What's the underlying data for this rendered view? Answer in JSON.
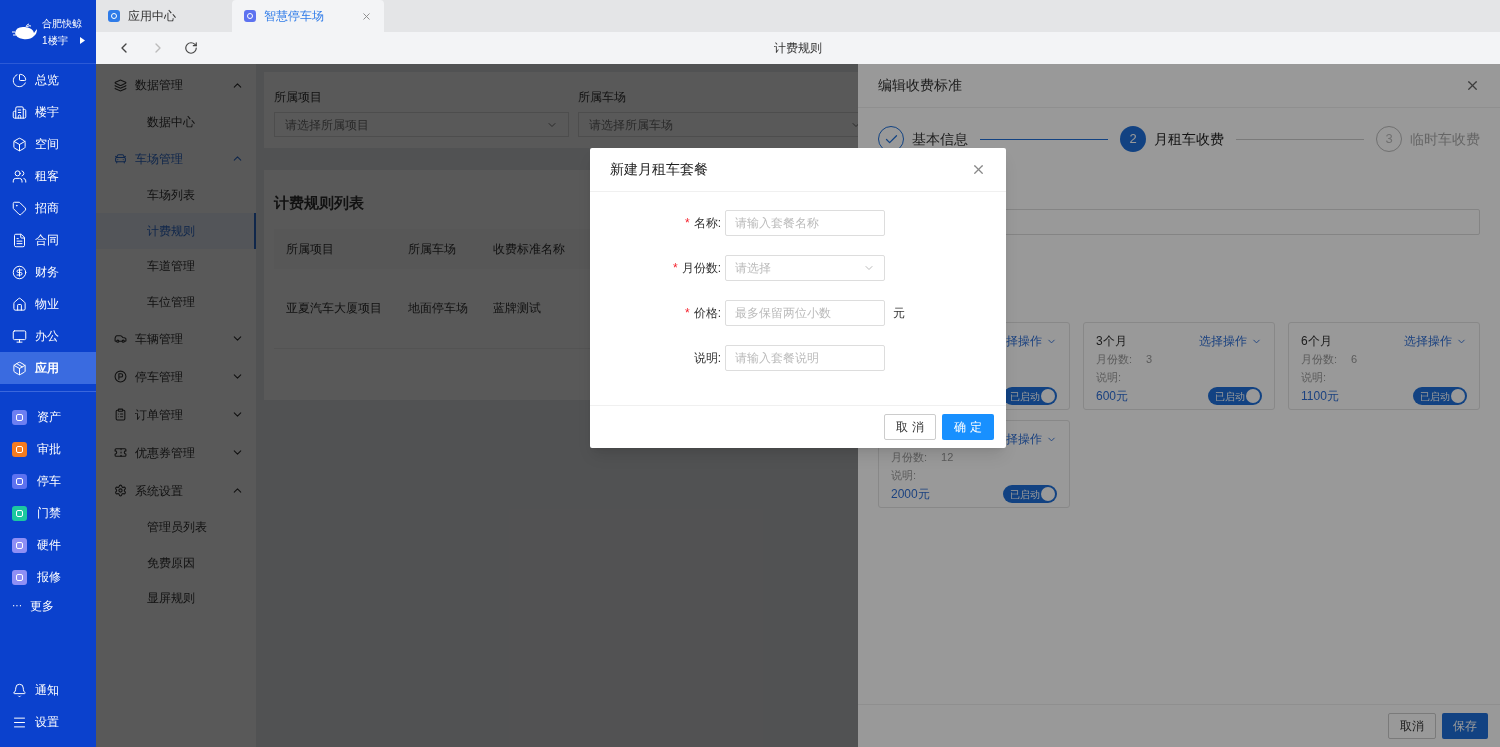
{
  "app_sidebar": {
    "org": "合肥快鲸",
    "building": "1楼宇",
    "nav": [
      {
        "label": "总览",
        "selected": false
      },
      {
        "label": "楼宇",
        "selected": false
      },
      {
        "label": "空间",
        "selected": false
      },
      {
        "label": "租客",
        "selected": false
      },
      {
        "label": "招商",
        "selected": false
      },
      {
        "label": "合同",
        "selected": false
      },
      {
        "label": "财务",
        "selected": false
      },
      {
        "label": "物业",
        "selected": false
      },
      {
        "label": "办公",
        "selected": false
      },
      {
        "label": "应用",
        "selected": true
      }
    ],
    "apps": [
      {
        "label": "资产",
        "color": "#6d7ff2"
      },
      {
        "label": "审批",
        "color": "#f47b20"
      },
      {
        "label": "停车",
        "color": "#5d72f0"
      },
      {
        "label": "门禁",
        "color": "#1cc8a0"
      },
      {
        "label": "硬件",
        "color": "#8f8ff5"
      },
      {
        "label": "报修",
        "color": "#8f8ff5"
      }
    ],
    "more": {
      "icon": "···",
      "label": "更多"
    },
    "bottom": [
      {
        "label": "通知"
      },
      {
        "label": "设置"
      }
    ]
  },
  "tabs": [
    {
      "label": "应用中心",
      "selected": false,
      "closable": false
    },
    {
      "label": "智慧停车场",
      "selected": true,
      "closable": true
    }
  ],
  "nav_bar": {
    "title": "计费规则"
  },
  "module_menu": [
    {
      "label": "数据管理",
      "expanded": true,
      "children": [
        {
          "label": "数据中心",
          "selected": false
        }
      ]
    },
    {
      "label": "车场管理",
      "expanded": true,
      "children": [
        {
          "label": "车场列表",
          "selected": false
        },
        {
          "label": "计费规则",
          "selected": true
        },
        {
          "label": "车道管理",
          "selected": false
        },
        {
          "label": "车位管理",
          "selected": false
        }
      ]
    },
    {
      "label": "车辆管理",
      "expanded": false
    },
    {
      "label": "停车管理",
      "expanded": false
    },
    {
      "label": "订单管理",
      "expanded": false
    },
    {
      "label": "优惠券管理",
      "expanded": false
    },
    {
      "label": "系统设置",
      "expanded": true,
      "children": [
        {
          "label": "管理员列表",
          "selected": false
        },
        {
          "label": "免费原因",
          "selected": false
        },
        {
          "label": "显屏规则",
          "selected": false
        }
      ]
    }
  ],
  "filters": [
    {
      "label": "所属项目",
      "placeholder": "请选择所属项目"
    },
    {
      "label": "所属车场",
      "placeholder": "请选择所属车场"
    }
  ],
  "rule_list": {
    "title": "计费规则列表",
    "columns": [
      "所属项目",
      "所属车场",
      "收费标准名称"
    ],
    "rows": [
      [
        "亚夏汽车大厦项目",
        "地面停车场",
        "蓝牌测试"
      ]
    ]
  },
  "drawer": {
    "title": "编辑收费标准",
    "steps": [
      {
        "label": "基本信息",
        "completed": true,
        "current": false
      },
      {
        "number": "2",
        "label": "月租车收费",
        "completed": false,
        "current": true
      },
      {
        "number": "3",
        "label": "临时车收费",
        "completed": false,
        "current": false
      }
    ],
    "plans": [
      {
        "action": "择操作",
        "toggle": {
          "label": "已启动",
          "on": true
        }
      },
      {
        "title": "3个月",
        "action": "选择操作",
        "months_label": "月份数:",
        "months": "3",
        "desc_label": "说明:",
        "price": "600元",
        "toggle": {
          "label": "已启动",
          "on": true
        }
      },
      {
        "title": "6个月",
        "action": "选择操作",
        "months_label": "月份数:",
        "months": "6",
        "desc_label": "说明:",
        "price": "1100元",
        "toggle": {
          "label": "已启动",
          "on": true
        }
      },
      {
        "action": "择操作",
        "months_label": "月份数:",
        "months": "12",
        "desc_label": "说明:",
        "price": "2000元",
        "toggle": {
          "label": "已启动",
          "on": true
        }
      }
    ],
    "buttons": [
      {
        "label": "取消",
        "kind": "default"
      },
      {
        "label": "保存",
        "kind": "primary"
      }
    ]
  },
  "dialog": {
    "title": "新建月租车套餐",
    "fields": [
      {
        "required_mark": "*",
        "label": "名称:",
        "kind": "input",
        "placeholder": "请输入套餐名称"
      },
      {
        "required_mark": "*",
        "label": "月份数:",
        "kind": "select",
        "placeholder": "请选择"
      },
      {
        "required_mark": "*",
        "label": "价格:",
        "kind": "input",
        "placeholder": "最多保留两位小数",
        "suffix": "元"
      },
      {
        "label": "说明:",
        "kind": "input",
        "placeholder": "请输入套餐说明"
      }
    ],
    "buttons": [
      {
        "label": "取 消",
        "kind": "default"
      },
      {
        "label": "确 定",
        "kind": "primary"
      }
    ]
  }
}
